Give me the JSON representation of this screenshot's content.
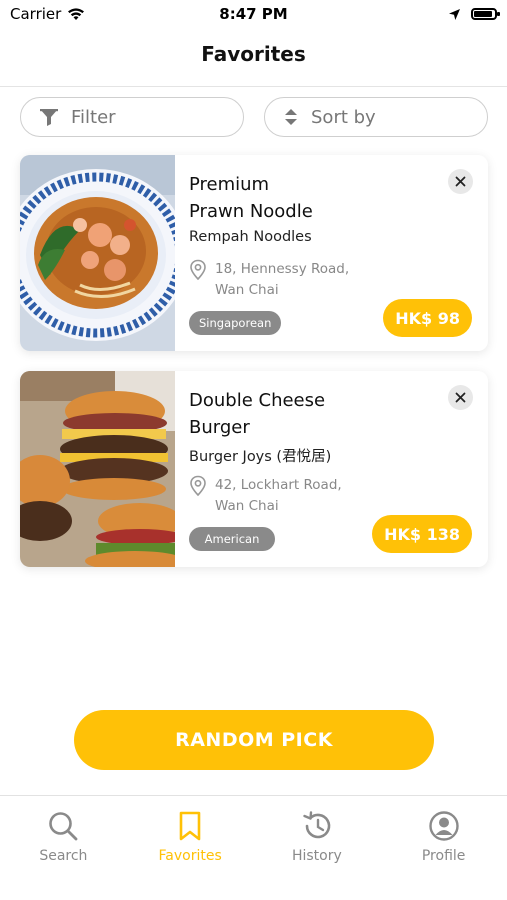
{
  "status_bar": {
    "carrier": "Carrier",
    "time": "8:47 PM"
  },
  "header": {
    "title": "Favorites"
  },
  "controls": {
    "filter_label": "Filter",
    "sort_label": "Sort by"
  },
  "favorites": [
    {
      "title_line1": "Premium",
      "title_line2": "Prawn Noodle",
      "restaurant": "Rempah Noodles",
      "address_line1": "18, Hennessy Road,",
      "address_line2": "Wan Chai",
      "cuisine": "Singaporean",
      "price": "HK$ 98",
      "image": "prawn-noodle-photo"
    },
    {
      "title_line1": "Double Cheese",
      "title_line2": "Burger",
      "restaurant": "Burger Joys (君悅居)",
      "address_line1": "42, Lockhart Road,",
      "address_line2": "Wan Chai",
      "cuisine": "American",
      "price": "HK$ 138",
      "image": "cheeseburger-photo"
    }
  ],
  "random_pick": {
    "label": "RANDOM PICK"
  },
  "tab_bar": {
    "tabs": [
      {
        "label": "Search",
        "icon": "search-icon",
        "active": false
      },
      {
        "label": "Favorites",
        "icon": "bookmark-icon",
        "active": true
      },
      {
        "label": "History",
        "icon": "history-icon",
        "active": false
      },
      {
        "label": "Profile",
        "icon": "profile-icon",
        "active": false
      }
    ]
  },
  "colors": {
    "accent": "#ffc107",
    "badge_gray": "#8a8a8a",
    "tab_inactive": "#8a8a8a"
  }
}
